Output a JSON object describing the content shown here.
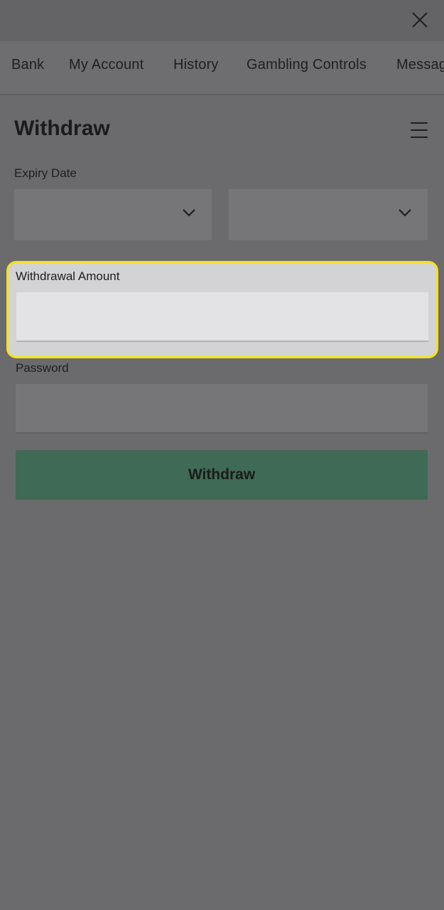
{
  "nav": {
    "tabs": [
      {
        "label": "Bank"
      },
      {
        "label": "My Account"
      },
      {
        "label": "History"
      },
      {
        "label": "Gambling Controls"
      },
      {
        "label": "Messages"
      }
    ],
    "close_icon": "close-icon"
  },
  "page": {
    "title": "Withdraw",
    "menu_icon": "hamburger-menu-icon"
  },
  "form": {
    "expiry_label": "Expiry Date",
    "expiry_month_value": "",
    "expiry_year_value": "",
    "amount_label": "Withdrawal Amount",
    "amount_value": "",
    "password_label": "Password",
    "password_value": "",
    "submit_label": "Withdraw"
  },
  "colors": {
    "highlight_border": "#f5e21a",
    "button": "#3f6a55",
    "overlay": "#6b6b6d"
  }
}
